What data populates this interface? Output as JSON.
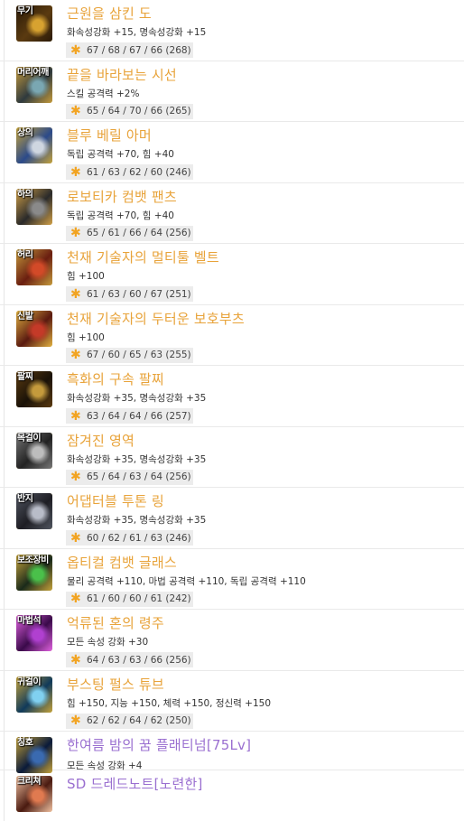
{
  "items": [
    {
      "slot": "무기",
      "name": "근원을 삼킨 도",
      "stat": "화속성강화 +15, 명속성강화 +15",
      "card": "67 / 68 / 67 / 66 (268)",
      "name_color": "#e8a33a",
      "icon_colors": [
        "#5a3a10",
        "#d7a230",
        "#2a1a08"
      ],
      "icon": "sword-icon"
    },
    {
      "slot": "머리어깨",
      "name": "끝을 바라보는 시선",
      "stat": "스킬 공격력 +2%",
      "card": "65 / 64 / 70 / 66 (265)",
      "name_color": "#e8a33a",
      "icon_colors": [
        "#2f3a3e",
        "#7aa7b2",
        "#c49a3c"
      ],
      "icon": "shoulder-armor-icon"
    },
    {
      "slot": "상의",
      "name": "블루 베릴 아머",
      "stat": "독립 공격력 +70, 힘 +40",
      "card": "61 / 63 / 62 / 60 (246)",
      "name_color": "#e8a33a",
      "icon_colors": [
        "#2b4a8a",
        "#cfd6e0",
        "#c4a23b"
      ],
      "icon": "armor-icon"
    },
    {
      "slot": "하의",
      "name": "로보티카 컴뱃 팬츠",
      "stat": "독립 공격력 +70, 힘 +40",
      "card": "65 / 61 / 66 / 64 (256)",
      "name_color": "#e8a33a",
      "icon_colors": [
        "#2a2a2a",
        "#8a8a8a",
        "#d0a048"
      ],
      "icon": "pants-icon"
    },
    {
      "slot": "허리",
      "name": "천재 기술자의 멀티툴 벨트",
      "stat": "힘 +100",
      "card": "61 / 63 / 60 / 67 (251)",
      "name_color": "#e8a33a",
      "icon_colors": [
        "#6a1e10",
        "#d24a28",
        "#c49a3c"
      ],
      "icon": "belt-icon"
    },
    {
      "slot": "신발",
      "name": "천재 기술자의 두터운 보호부츠",
      "stat": "힘 +100",
      "card": "67 / 60 / 65 / 63 (255)",
      "name_color": "#e8a33a",
      "icon_colors": [
        "#5a1a10",
        "#c43a28",
        "#e0b040"
      ],
      "icon": "boots-icon"
    },
    {
      "slot": "팔찌",
      "name": "흑화의 구속 팔찌",
      "stat": "화속성강화 +35, 명속성강화 +35",
      "card": "63 / 64 / 64 / 66 (257)",
      "name_color": "#e8a33a",
      "icon_colors": [
        "#1a1208",
        "#c49a3c",
        "#5a3a10"
      ],
      "icon": "bracelet-icon"
    },
    {
      "slot": "목걸이",
      "name": "잠겨진 영역",
      "stat": "화속성강화 +35, 명속성강화 +35",
      "card": "65 / 64 / 63 / 64 (256)",
      "name_color": "#e8a33a",
      "icon_colors": [
        "#222222",
        "#bdbdbd",
        "#777777"
      ],
      "icon": "necklace-icon"
    },
    {
      "slot": "반지",
      "name": "어댑터블 투톤 링",
      "stat": "화속성강화 +35, 명속성강화 +35",
      "card": "60 / 62 / 61 / 63 (246)",
      "name_color": "#e8a33a",
      "icon_colors": [
        "#1e1e24",
        "#b8bcc8",
        "#505560"
      ],
      "icon": "ring-icon"
    },
    {
      "slot": "보조장비",
      "name": "옵티컬 컴뱃 글래스",
      "stat": "물리 공격력 +110, 마법 공격력 +110, 독립 공격력 +110",
      "card": "61 / 60 / 60 / 61 (242)",
      "name_color": "#e8a33a",
      "icon_colors": [
        "#1a2a1a",
        "#4ac04a",
        "#c4a23b"
      ],
      "icon": "glasses-icon"
    },
    {
      "slot": "마법석",
      "name": "억류된 혼의 령주",
      "stat": "모든 속성 강화 +30",
      "card": "64 / 63 / 63 / 66 (256)",
      "name_color": "#e8a33a",
      "icon_colors": [
        "#3a0a4a",
        "#b040d0",
        "#e060e0"
      ],
      "icon": "magic-stone-icon"
    },
    {
      "slot": "귀걸이",
      "name": "부스팅 펄스 튜브",
      "stat": "힘 +150, 지능 +150, 체력 +150, 정신력 +150",
      "card": "62 / 62 / 64 / 62 (250)",
      "name_color": "#e8a33a",
      "icon_colors": [
        "#103a5a",
        "#80d0f0",
        "#c4a23b"
      ],
      "icon": "earring-icon"
    },
    {
      "slot": "칭호",
      "name": "한여름 밤의 꿈 플래티넘[75Lv]",
      "stat": "모든 속성 강화 +4",
      "card": "",
      "name_color": "#9a6fd0",
      "icon_colors": [
        "#0a1a3a",
        "#3a6ab0",
        "#c4a23b"
      ],
      "icon": "title-icon"
    },
    {
      "slot": "크리쳐",
      "name": "SD 드레드노트[노련한]",
      "stat": "",
      "card": "",
      "name_color": "#9a6fd0",
      "icon_colors": [
        "#4a1a10",
        "#e07a50",
        "#f0c0a0"
      ],
      "icon": "creature-icon"
    }
  ],
  "colors": {
    "accent_orange": "#e8a33a",
    "accent_purple": "#9a6fd0",
    "card_bg": "#ececec",
    "star": "#f2a422"
  },
  "card_icon": "star-icon"
}
